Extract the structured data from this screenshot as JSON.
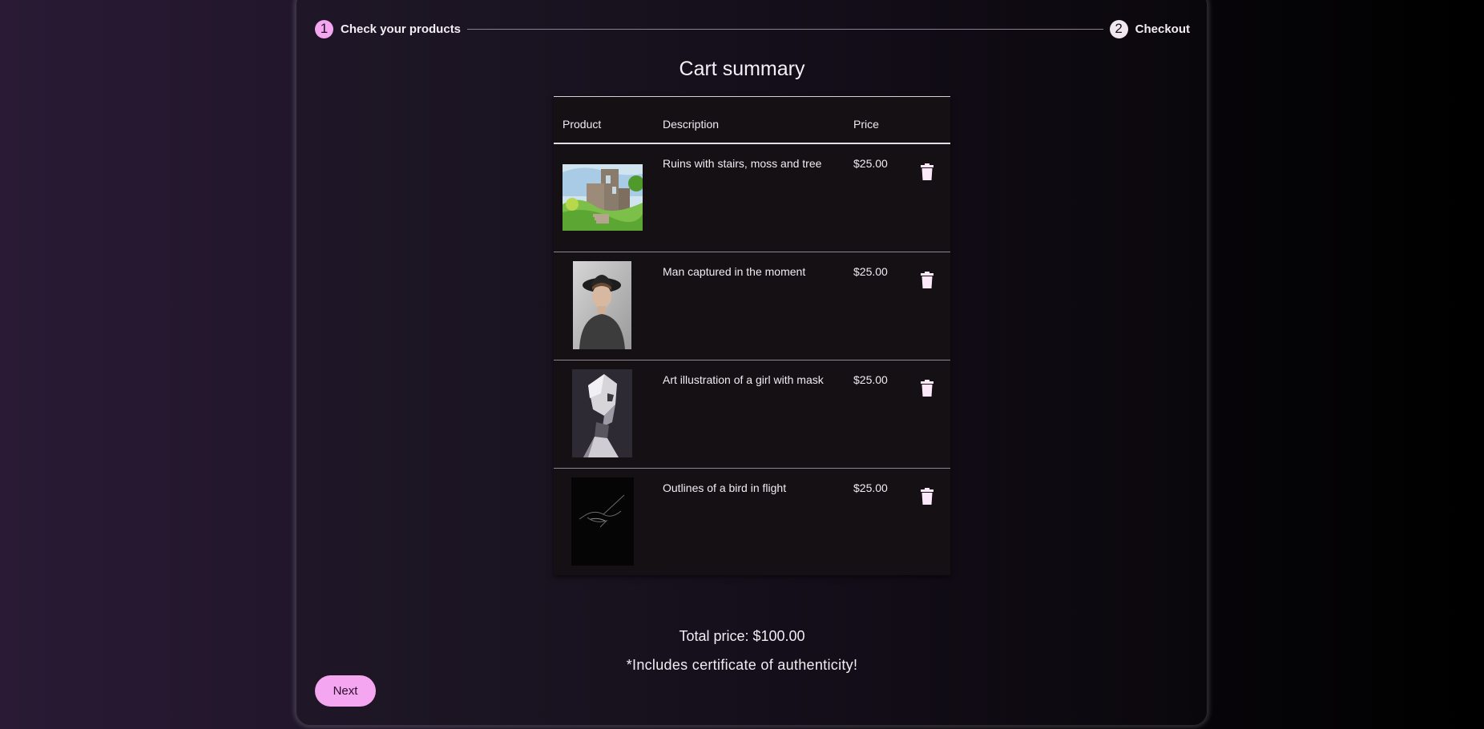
{
  "stepper": {
    "steps": [
      {
        "number": "1",
        "label": "Check your products"
      },
      {
        "number": "2",
        "label": "Checkout"
      }
    ]
  },
  "page_title": "Cart summary",
  "table": {
    "headers": {
      "product": "Product",
      "description": "Description",
      "price": "Price"
    },
    "rows": [
      {
        "description": "Ruins with stairs, moss and tree",
        "price": "$25.00"
      },
      {
        "description": "Man captured in the moment",
        "price": "$25.00"
      },
      {
        "description": "Art illustration of a girl with mask",
        "price": "$25.00"
      },
      {
        "description": "Outlines of a bird in flight",
        "price": "$25.00"
      }
    ]
  },
  "summary": {
    "total": "Total price: $100.00",
    "note": "*Includes certificate of authenticity!"
  },
  "actions": {
    "next_label": "Next"
  },
  "colors": {
    "accent": "#f4a6f0",
    "background": "#141013"
  }
}
